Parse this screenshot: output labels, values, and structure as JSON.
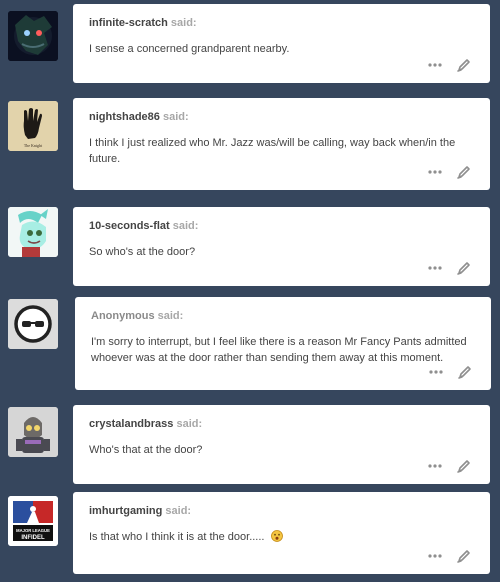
{
  "said_label": "said:",
  "posts": [
    {
      "username": "infinite-scratch",
      "text": "I sense a concerned grandparent nearby.",
      "avatar": "dark-creature-avatar"
    },
    {
      "username": "nightshade86",
      "text": "I think I just realized who Mr. Jazz was/will be calling, way back when/in the future.",
      "avatar": "black-handprint-avatar",
      "avatar_caption": "The Knight"
    },
    {
      "username": "10-seconds-flat",
      "text": "So who's at the door?",
      "avatar": "pony-character-avatar"
    },
    {
      "username": "Anonymous",
      "text": "I'm sorry to interrupt, but I feel like there is a reason Mr Fancy Pants admitted whoever was at the door rather than sending them away at this moment.",
      "avatar": "anonymous-sunglasses-avatar"
    },
    {
      "username": "crystalandbrass",
      "text": "Who's that at the door?",
      "avatar": "armored-character-avatar"
    },
    {
      "username": "imhurtgaming",
      "text": "Is that who I think it is at the door.....",
      "avatar": "major-league-infidel-avatar",
      "avatar_caption": "MAJOR LEAGUE INFIDEL",
      "emoji": "surprised-face-emoji"
    }
  ],
  "colors": {
    "background": "#36465d",
    "card": "#ffffff",
    "text": "#444444",
    "muted": "#a7a7a7",
    "icon": "#8f8f8f"
  },
  "icons": {
    "more": "ellipsis-icon",
    "edit": "pencil-icon"
  }
}
